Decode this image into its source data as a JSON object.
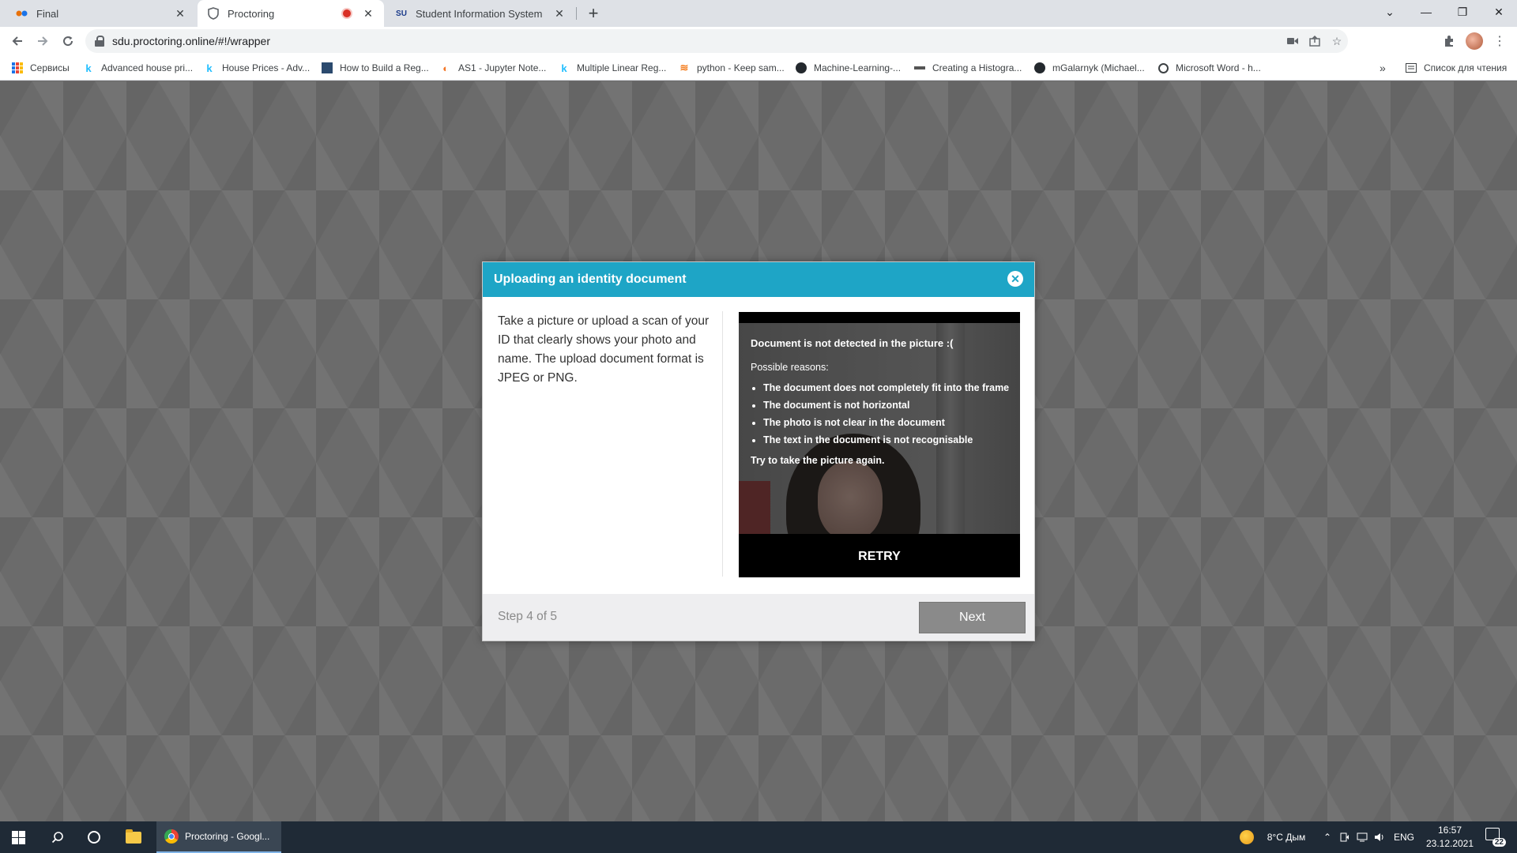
{
  "browser": {
    "tabs": [
      {
        "title": "Final",
        "active": false
      },
      {
        "title": "Proctoring",
        "active": true,
        "recording": true
      },
      {
        "title": "Student Information System",
        "active": false
      }
    ],
    "url": "sdu.proctoring.online/#!/wrapper",
    "bookmarks": [
      {
        "label": "Сервисы",
        "icon": "apps-icon"
      },
      {
        "label": "Advanced house pri...",
        "icon": "kaggle-icon"
      },
      {
        "label": "House Prices - Adv...",
        "icon": "kaggle-icon"
      },
      {
        "label": "How to Build a Reg...",
        "icon": "site-icon"
      },
      {
        "label": "AS1 - Jupyter Note...",
        "icon": "jupyter-icon"
      },
      {
        "label": "Multiple Linear Reg...",
        "icon": "kaggle-icon"
      },
      {
        "label": "python - Keep sam...",
        "icon": "stackoverflow-icon"
      },
      {
        "label": "Machine-Learning-...",
        "icon": "github-icon"
      },
      {
        "label": "Creating a Histogra...",
        "icon": "site-icon"
      },
      {
        "label": "mGalarnyk (Michael...",
        "icon": "github-icon"
      },
      {
        "label": "Microsoft Word - h...",
        "icon": "globe-icon"
      }
    ],
    "overflow_label": "»",
    "reading_list": "Список для чтения"
  },
  "modal": {
    "title": "Uploading an identity document",
    "instructions": "Take a picture or upload a scan of your ID that clearly shows your photo and name. The upload document format is JPEG or PNG.",
    "camera": {
      "error_title": "Document is not detected in the picture :(",
      "reasons_label": "Possible reasons:",
      "reasons": [
        "The document does not completely fit into the frame",
        "The document is not horizontal",
        "The photo is not clear in the document",
        "The text in the document is not recognisable"
      ],
      "try_again": "Try to take the picture again.",
      "retry_label": "RETRY"
    },
    "step_text": "Step 4 of 5",
    "next_label": "Next"
  },
  "taskbar": {
    "active_app": "Proctoring - Googl...",
    "weather": "8°C  Дым",
    "language": "ENG",
    "time": "16:57",
    "date": "23.12.2021",
    "notification_count": "22"
  },
  "colors": {
    "modal_header": "#1ea5c6",
    "page_background": "#6b6b6b",
    "next_button": "#8a8a8a",
    "taskbar": "#1f2a36"
  }
}
